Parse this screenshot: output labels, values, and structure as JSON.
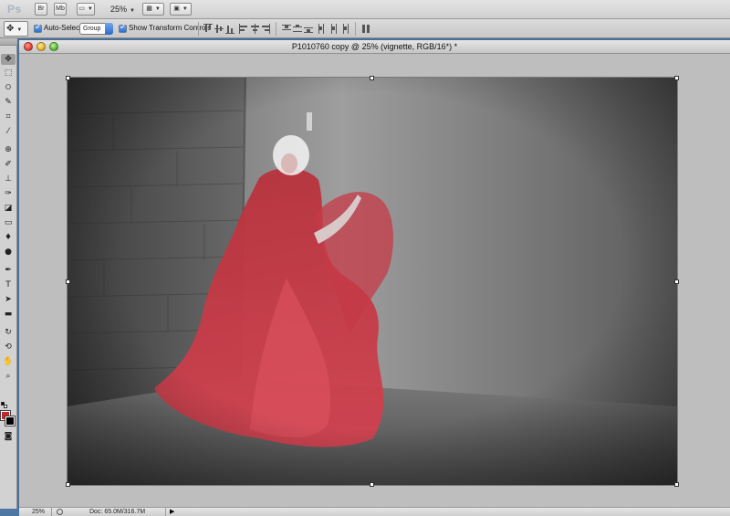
{
  "app": {
    "logo": "Ps",
    "bridge_label": "Br",
    "minibridge_label": "Mb",
    "zoom_value": "25%"
  },
  "options": {
    "auto_select_label": "Auto-Select:",
    "auto_select_checked": true,
    "auto_select_target": "Group",
    "show_transform_label": "Show Transform Controls",
    "show_transform_checked": true
  },
  "document": {
    "title": "P1010760 copy @ 25% (vignette, RGB/16*) *"
  },
  "status": {
    "zoom": "25%",
    "doc_size": "Doc: 65.0M/316.7M"
  },
  "colors": {
    "foreground": "#c4272d",
    "background": "#000000"
  },
  "tools": [
    "move-icon",
    "marquee-icon",
    "lasso-icon",
    "quick-select-icon",
    "crop-icon",
    "eyedropper-icon",
    "healing-brush-icon",
    "brush-icon",
    "clone-stamp-icon",
    "history-brush-icon",
    "eraser-icon",
    "gradient-icon",
    "blur-icon",
    "dodge-icon",
    "pen-icon",
    "type-icon",
    "path-select-icon",
    "shape-icon",
    "3d-rotate-icon",
    "3d-orbit-icon",
    "hand-icon",
    "zoom-icon"
  ]
}
